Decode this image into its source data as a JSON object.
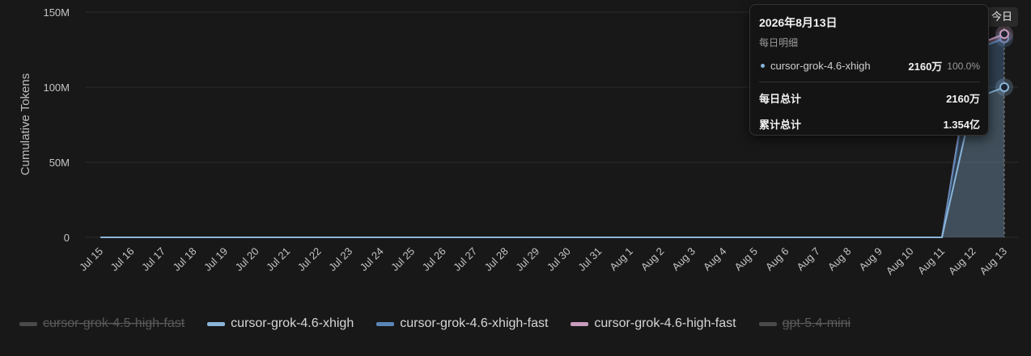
{
  "chart_data": {
    "type": "area",
    "ylabel": "Cumulative Tokens",
    "ylim": [
      0,
      150000000
    ],
    "y_ticks": [
      0,
      50000000,
      100000000,
      150000000
    ],
    "y_tick_labels": [
      "0",
      "50M",
      "100M",
      "150M"
    ],
    "grid": true,
    "x": [
      "Jul 15",
      "Jul 16",
      "Jul 17",
      "Jul 18",
      "Jul 19",
      "Jul 20",
      "Jul 21",
      "Jul 22",
      "Jul 23",
      "Jul 24",
      "Jul 25",
      "Jul 26",
      "Jul 27",
      "Jul 28",
      "Jul 29",
      "Jul 30",
      "Jul 31",
      "Aug 1",
      "Aug 2",
      "Aug 3",
      "Aug 4",
      "Aug 5",
      "Aug 6",
      "Aug 7",
      "Aug 8",
      "Aug 9",
      "Aug 10",
      "Aug 11",
      "Aug 12",
      "Aug 13"
    ],
    "stacked": true,
    "legend_position": "bottom",
    "series": [
      {
        "name": "cursor-grok-4.5-high-fast",
        "color": "#6b6b6b",
        "visible": false,
        "values": [
          0,
          0,
          0,
          0,
          0,
          0,
          0,
          0,
          0,
          0,
          0,
          0,
          0,
          0,
          0,
          0,
          0,
          0,
          0,
          0,
          0,
          0,
          0,
          0,
          0,
          0,
          0,
          0,
          0,
          0
        ]
      },
      {
        "name": "cursor-grok-4.6-xhigh",
        "color": "#8ab4d8",
        "visible": true,
        "values": [
          0,
          0,
          0,
          0,
          0,
          0,
          0,
          0,
          0,
          0,
          0,
          0,
          0,
          0,
          0,
          0,
          0,
          0,
          0,
          0,
          0,
          0,
          0,
          0,
          0,
          0,
          0,
          0,
          92000000,
          100000000
        ]
      },
      {
        "name": "cursor-grok-4.6-xhigh-fast",
        "color": "#5b86b8",
        "visible": true,
        "values": [
          0,
          0,
          0,
          0,
          0,
          0,
          0,
          0,
          0,
          0,
          0,
          0,
          0,
          0,
          0,
          0,
          0,
          0,
          0,
          0,
          0,
          0,
          0,
          0,
          0,
          0,
          0,
          0,
          32500000,
          32500000
        ]
      },
      {
        "name": "cursor-grok-4.6-high-fast",
        "color": "#c89bbd",
        "visible": true,
        "values": [
          0,
          0,
          0,
          0,
          0,
          0,
          0,
          0,
          0,
          0,
          0,
          0,
          0,
          0,
          0,
          0,
          0,
          0,
          0,
          0,
          0,
          0,
          0,
          0,
          0,
          0,
          0,
          0,
          2900000,
          2900000
        ]
      },
      {
        "name": "gpt-5.4-mini",
        "color": "#6b6b6b",
        "visible": false,
        "values": [
          0,
          0,
          0,
          0,
          0,
          0,
          0,
          0,
          0,
          0,
          0,
          0,
          0,
          0,
          0,
          0,
          0,
          0,
          0,
          0,
          0,
          0,
          0,
          0,
          0,
          0,
          0,
          0,
          0,
          0
        ]
      }
    ]
  },
  "today_label": "今日",
  "tooltip": {
    "date": "2026年8月13日",
    "subtitle": "每日明细",
    "rows": [
      {
        "name": "cursor-grok-4.6-xhigh",
        "value": "2160万",
        "pct": "100.0%",
        "color": "#8ab4d8"
      }
    ],
    "daily_total_label": "每日总计",
    "daily_total_value": "2160万",
    "cumulative_total_label": "累计总计",
    "cumulative_total_value": "1.354亿"
  },
  "legend": [
    {
      "label": "cursor-grok-4.5-high-fast",
      "color": "#6b6b6b",
      "active": false
    },
    {
      "label": "cursor-grok-4.6-xhigh",
      "color": "#8ab4d8",
      "active": true
    },
    {
      "label": "cursor-grok-4.6-xhigh-fast",
      "color": "#5b86b8",
      "active": true
    },
    {
      "label": "cursor-grok-4.6-high-fast",
      "color": "#c89bbd",
      "active": true
    },
    {
      "label": "gpt-5.4-mini",
      "color": "#6b6b6b",
      "active": false
    }
  ]
}
